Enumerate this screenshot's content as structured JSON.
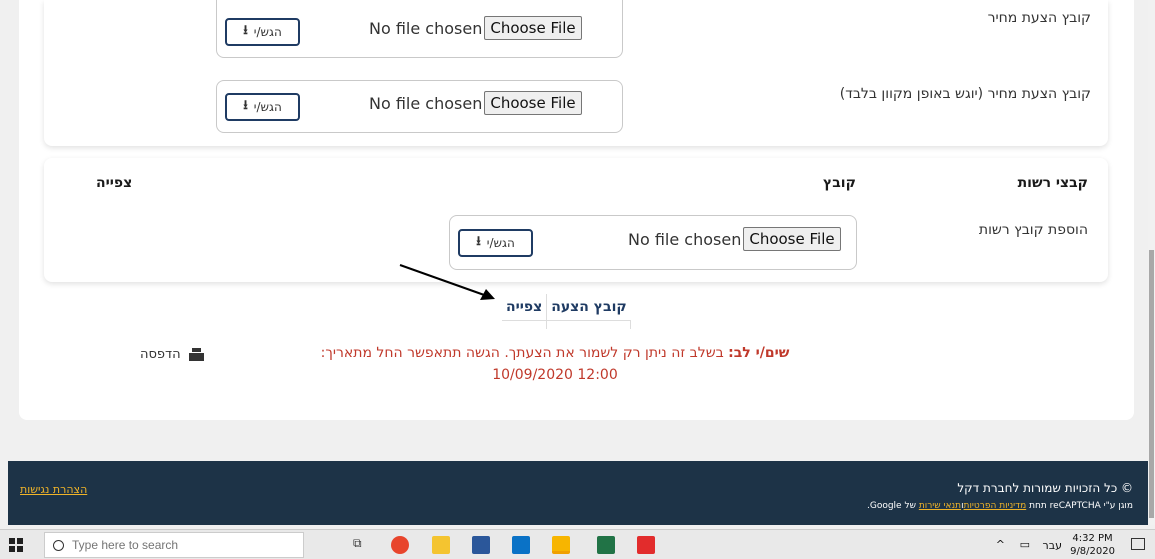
{
  "upload_section": {
    "price_offer_label": "קובץ הצעת מחיר",
    "price_offer_online_label": "קובץ הצעת מחיר (יוגש באופן מקוון בלבד)",
    "no_file_text": "No file chosen",
    "choose_file_label": "Choose File",
    "submit_label": "הגש/י"
  },
  "optional_files": {
    "header_title": "קבצי רשות",
    "header_file": "קובץ",
    "header_view": "צפייה",
    "add_optional_label": "הוספת קובץ רשות",
    "no_file_text": "No file chosen",
    "choose_file_label": "Choose File",
    "submit_label": "הגש/י"
  },
  "offer_table": {
    "col_file": "קובץ הצעה",
    "col_view": "צפייה"
  },
  "notice": {
    "strong": "שים/י לב:",
    "text": "בשלב זה ניתן רק לשמור את הצעתך. הגשה תתאפשר החל מתאריך: 12:00 10/09/2020"
  },
  "print": {
    "label": "הדפסה"
  },
  "footer": {
    "copyright": "© כל הזכויות שמורות לחברת דקל",
    "captcha_prefix": "מוגן ע\"י reCAPTCHA תחת",
    "privacy_link": "מדיניות הפרטיות",
    "and": "ו",
    "terms_link": "תנאי שירות",
    "captcha_suffix": "של Google.",
    "accessibility_link": "הצהרת נגישות"
  },
  "taskbar": {
    "search_placeholder": "Type here to search",
    "time": "4:32 PM",
    "date": "9/8/2020",
    "lang": "עבר"
  }
}
